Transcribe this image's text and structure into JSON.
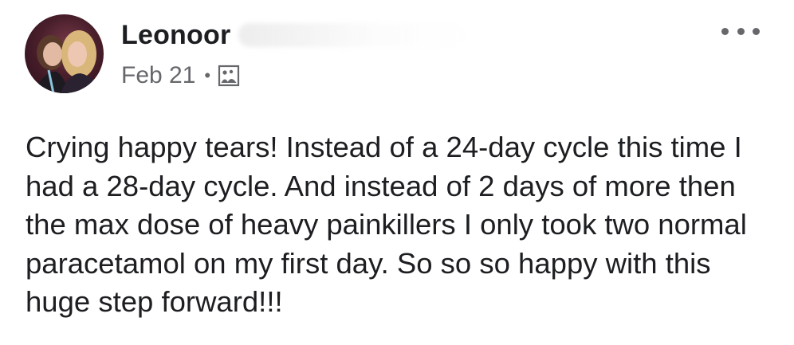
{
  "post": {
    "author_name": "Leonoor",
    "date": "Feb 21",
    "separator": "•",
    "audience_icon": "group-photo-icon",
    "more_icon": "more-dots-icon",
    "text": "Crying happy tears! Instead of a 24-day cycle this time I had a 28-day cycle. And instead of 2 days of more then the max dose of heavy painkillers I only took two normal paracetamol on my first day. So so so happy with this huge step forward!!!"
  },
  "colors": {
    "text_primary": "#1c1e21",
    "text_secondary": "#65676b",
    "background": "#ffffff"
  }
}
